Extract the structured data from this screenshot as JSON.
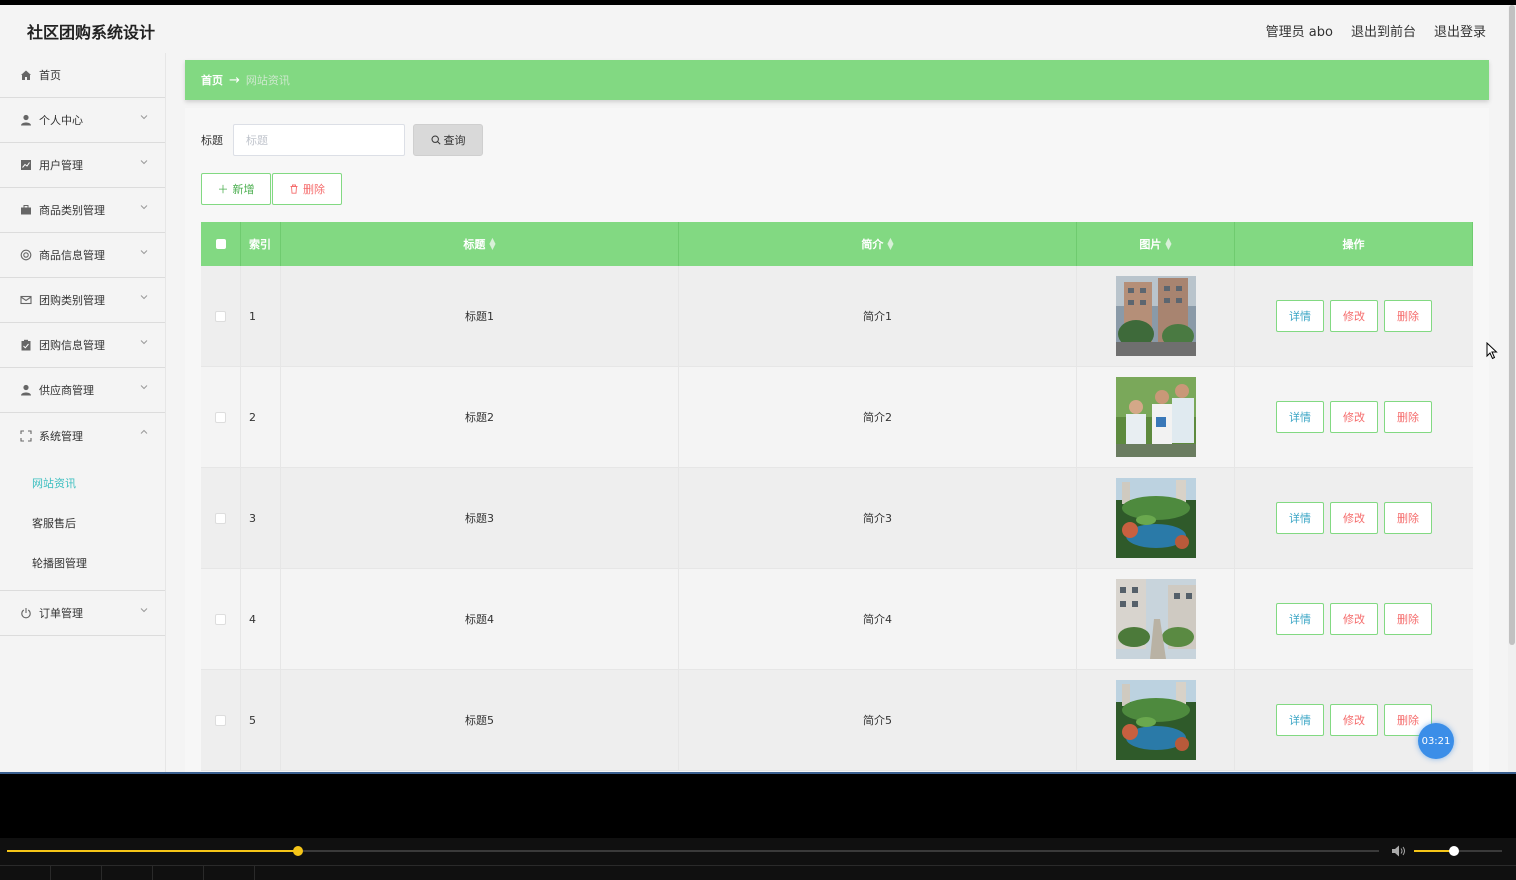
{
  "app": {
    "title": "社区团购系统设计"
  },
  "header": {
    "links": [
      "管理员 abo",
      "退出到前台",
      "退出登录"
    ]
  },
  "sidebar": {
    "items": [
      {
        "label": "首页",
        "icon": "home-icon",
        "arrow": false
      },
      {
        "label": "个人中心",
        "icon": "user-icon",
        "arrow": true
      },
      {
        "label": "用户管理",
        "icon": "chart-icon",
        "arrow": true
      },
      {
        "label": "商品类别管理",
        "icon": "briefcase-icon",
        "arrow": true
      },
      {
        "label": "商品信息管理",
        "icon": "circle-icon",
        "arrow": true
      },
      {
        "label": "团购类别管理",
        "icon": "mail-icon",
        "arrow": true
      },
      {
        "label": "团购信息管理",
        "icon": "clipboard-icon",
        "arrow": true
      },
      {
        "label": "供应商管理",
        "icon": "user-icon",
        "arrow": true
      },
      {
        "label": "系统管理",
        "icon": "fullscreen-icon",
        "arrow": true,
        "expanded": true
      }
    ],
    "submenu": [
      {
        "label": "网站资讯",
        "active": true
      },
      {
        "label": "客服售后",
        "active": false
      },
      {
        "label": "轮播图管理",
        "active": false
      }
    ],
    "last": {
      "label": "订单管理",
      "icon": "power-icon"
    }
  },
  "breadcrumb": {
    "home": "首页",
    "separator": "→",
    "current": "网站资讯"
  },
  "search": {
    "label": "标题",
    "placeholder": "标题",
    "button": "查询"
  },
  "actions": {
    "add": "新增",
    "delete": "删除"
  },
  "table": {
    "headers": {
      "index": "索引",
      "title": "标题",
      "intro": "简介",
      "image": "图片",
      "ops": "操作"
    },
    "rows": [
      {
        "index": "1",
        "title": "标题1",
        "intro": "简介1",
        "image": "building"
      },
      {
        "index": "2",
        "title": "标题2",
        "intro": "简介2",
        "image": "people"
      },
      {
        "index": "3",
        "title": "标题3",
        "intro": "简介3",
        "image": "garden"
      },
      {
        "index": "4",
        "title": "标题4",
        "intro": "简介4",
        "image": "street"
      },
      {
        "index": "5",
        "title": "标题5",
        "intro": "简介5",
        "image": "garden"
      }
    ],
    "op_labels": {
      "detail": "详情",
      "edit": "修改",
      "delete": "删除"
    }
  },
  "overlay": {
    "timer": "03:21"
  },
  "player": {
    "progress": 0.212,
    "volume": 0.45
  },
  "colors": {
    "accent": "#82d982",
    "active_text": "#3cbfc0",
    "danger": "#f56c6c",
    "player_accent": "#f5c518"
  }
}
